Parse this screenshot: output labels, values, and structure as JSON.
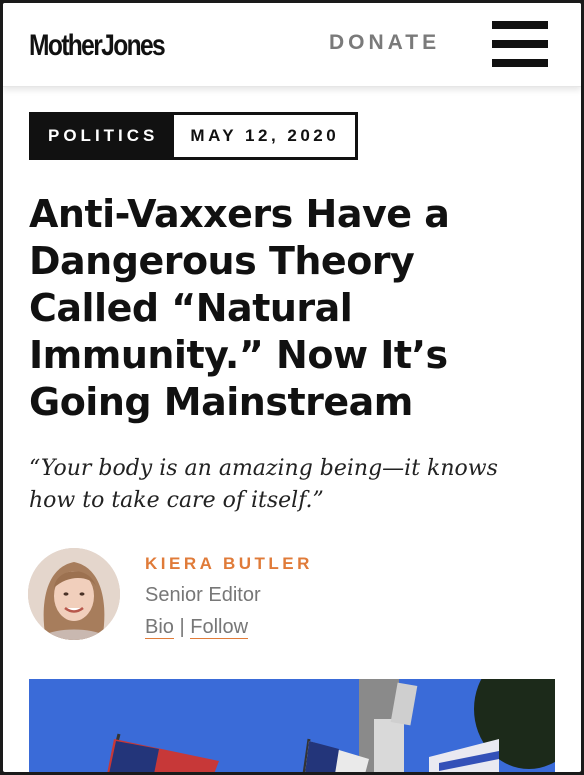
{
  "header": {
    "logo": "MotherJones",
    "donate_label": "DONATE",
    "menu_icon": "hamburger-menu-icon"
  },
  "article": {
    "category": "POLITICS",
    "date": "MAY 12, 2020",
    "headline_lines": [
      "Anti-Vaxxers Have a",
      "Dangerous Theory",
      "Called “Natural",
      "Immunity.” Now It’s",
      "Going Mainstream"
    ],
    "dek_lines": [
      "“Your body is an amazing being—it knows",
      "how to take care of itself.”"
    ]
  },
  "author": {
    "name": "KIERA BUTLER",
    "title": "Senior Editor",
    "bio_label": "Bio",
    "separator": "|",
    "follow_label": "Follow"
  },
  "colors": {
    "accent": "#e07b39",
    "text": "#111111",
    "muted": "#777777",
    "sky": "#3a6bd8"
  }
}
